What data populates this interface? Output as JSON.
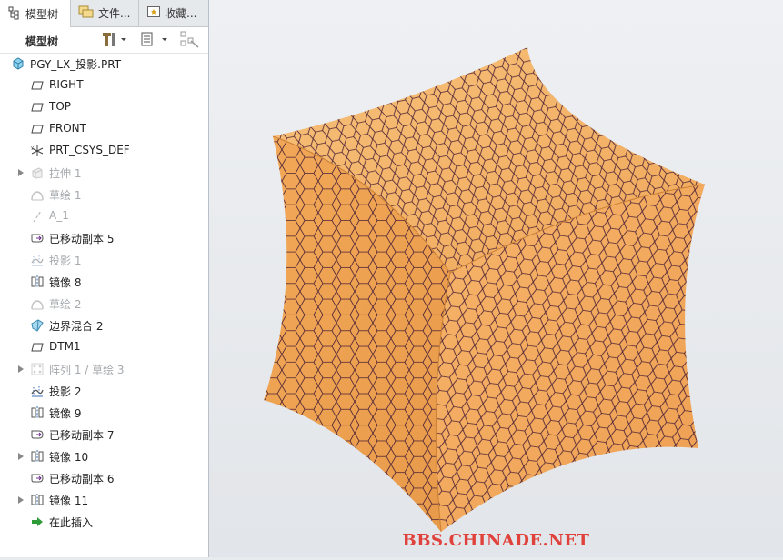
{
  "tabs": [
    {
      "label": "模型树",
      "icon": "tree-icon"
    },
    {
      "label": "文件...",
      "icon": "folders-icon"
    },
    {
      "label": "收藏...",
      "icon": "favorites-icon"
    }
  ],
  "toolbar": {
    "title": "模型树",
    "buttons": [
      "settings-tools-icon",
      "show-list-icon",
      "filter-icon"
    ]
  },
  "tree": {
    "root": "PGY_LX_投影.PRT",
    "items": [
      {
        "label": "RIGHT",
        "icon": "datum-plane-icon",
        "expandable": false,
        "dim": false
      },
      {
        "label": "TOP",
        "icon": "datum-plane-icon",
        "expandable": false,
        "dim": false
      },
      {
        "label": "FRONT",
        "icon": "datum-plane-icon",
        "expandable": false,
        "dim": false
      },
      {
        "label": "PRT_CSYS_DEF",
        "icon": "csys-icon",
        "expandable": false,
        "dim": false
      },
      {
        "label": "拉伸 1",
        "icon": "extrude-icon",
        "expandable": true,
        "dim": true
      },
      {
        "label": "草绘 1",
        "icon": "sketch-icon",
        "expandable": false,
        "dim": true
      },
      {
        "label": "A_1",
        "icon": "axis-icon",
        "expandable": false,
        "dim": true
      },
      {
        "label": "已移动副本 5",
        "icon": "moved-copy-icon",
        "expandable": false,
        "dim": false
      },
      {
        "label": "投影 1",
        "icon": "projection-icon",
        "expandable": false,
        "dim": true
      },
      {
        "label": "镜像 8",
        "icon": "mirror-icon",
        "expandable": false,
        "dim": false
      },
      {
        "label": "草绘 2",
        "icon": "sketch-icon",
        "expandable": false,
        "dim": true
      },
      {
        "label": "边界混合 2",
        "icon": "boundary-blend-icon",
        "expandable": false,
        "dim": false
      },
      {
        "label": "DTM1",
        "icon": "datum-plane-icon",
        "expandable": false,
        "dim": false
      },
      {
        "label": "阵列 1 / 草绘 3",
        "icon": "pattern-icon",
        "expandable": true,
        "dim": true
      },
      {
        "label": "投影 2",
        "icon": "projection-icon",
        "expandable": false,
        "dim": false
      },
      {
        "label": "镜像 9",
        "icon": "mirror-icon",
        "expandable": false,
        "dim": false
      },
      {
        "label": "已移动副本 7",
        "icon": "moved-copy-icon",
        "expandable": false,
        "dim": false
      },
      {
        "label": "镜像 10",
        "icon": "mirror-icon",
        "expandable": true,
        "dim": false
      },
      {
        "label": "已移动副本 6",
        "icon": "moved-copy-icon",
        "expandable": false,
        "dim": false
      },
      {
        "label": "镜像 11",
        "icon": "mirror-icon",
        "expandable": true,
        "dim": false
      },
      {
        "label": "在此插入",
        "icon": "insert-here-icon",
        "expandable": false,
        "dim": false
      }
    ]
  },
  "viewport": {
    "watermark": "BBS.CHINADE.NET",
    "surface_color": "#f1aa5c",
    "mesh_color": "#4a1f35"
  }
}
